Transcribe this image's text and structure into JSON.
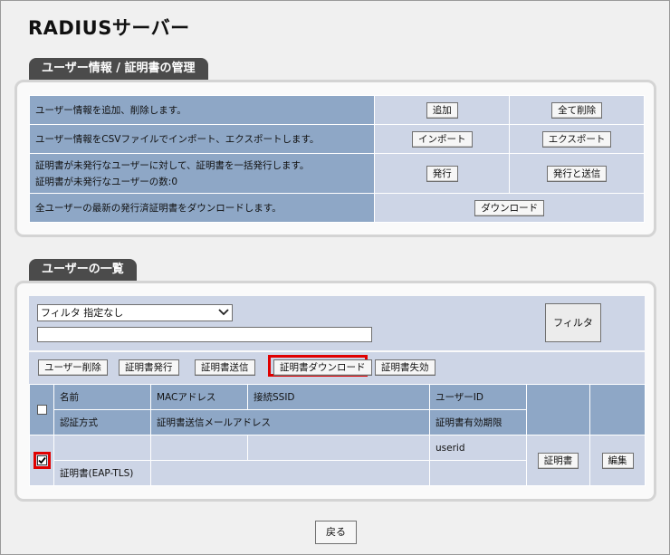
{
  "page": {
    "title": "RADIUSサーバー"
  },
  "user_mgmt": {
    "header": "ユーザー情報 / 証明書の管理",
    "rows": [
      {
        "desc": "ユーザー情報を追加、削除します。",
        "btn1": "追加",
        "btn2": "全て削除"
      },
      {
        "desc": "ユーザー情報をCSVファイルでインポート、エクスポートします。",
        "btn1": "インポート",
        "btn2": "エクスポート"
      },
      {
        "desc": "証明書が未発行なユーザーに対して、証明書を一括発行します。",
        "desc2": "証明書が未発行なユーザーの数:0",
        "btn1": "発行",
        "btn2": "発行と送信"
      },
      {
        "desc": "全ユーザーの最新の発行済証明書をダウンロードします。",
        "btn1": "ダウンロード"
      }
    ]
  },
  "user_list": {
    "header": "ユーザーの一覧",
    "filter_select": "フィルタ 指定なし",
    "filter_text": "",
    "filter_button": "フィルタ",
    "actions": {
      "delete": "ユーザー削除",
      "issue": "証明書発行",
      "send": "証明書送信",
      "download": "証明書ダウンロード",
      "revoke": "証明書失効"
    },
    "headers": {
      "name": "名前",
      "mac": "MACアドレス",
      "ssid": "接続SSID",
      "userid": "ユーザーID",
      "auth": "認証方式",
      "mail": "証明書送信メールアドレス",
      "expiry": "証明書有効期限"
    },
    "row": {
      "checked": true,
      "name": "",
      "mac": "",
      "ssid": "",
      "userid": "userid",
      "auth": "証明書(EAP-TLS)",
      "mail": "",
      "expiry": "",
      "cert_button": "証明書",
      "edit_button": "編集"
    }
  },
  "footer": {
    "back": "戻る"
  },
  "colors": {
    "highlight": "#e00000",
    "header_cell": "#8ea7c6",
    "data_cell": "#cdd5e6",
    "tab": "#4b4b4b"
  }
}
